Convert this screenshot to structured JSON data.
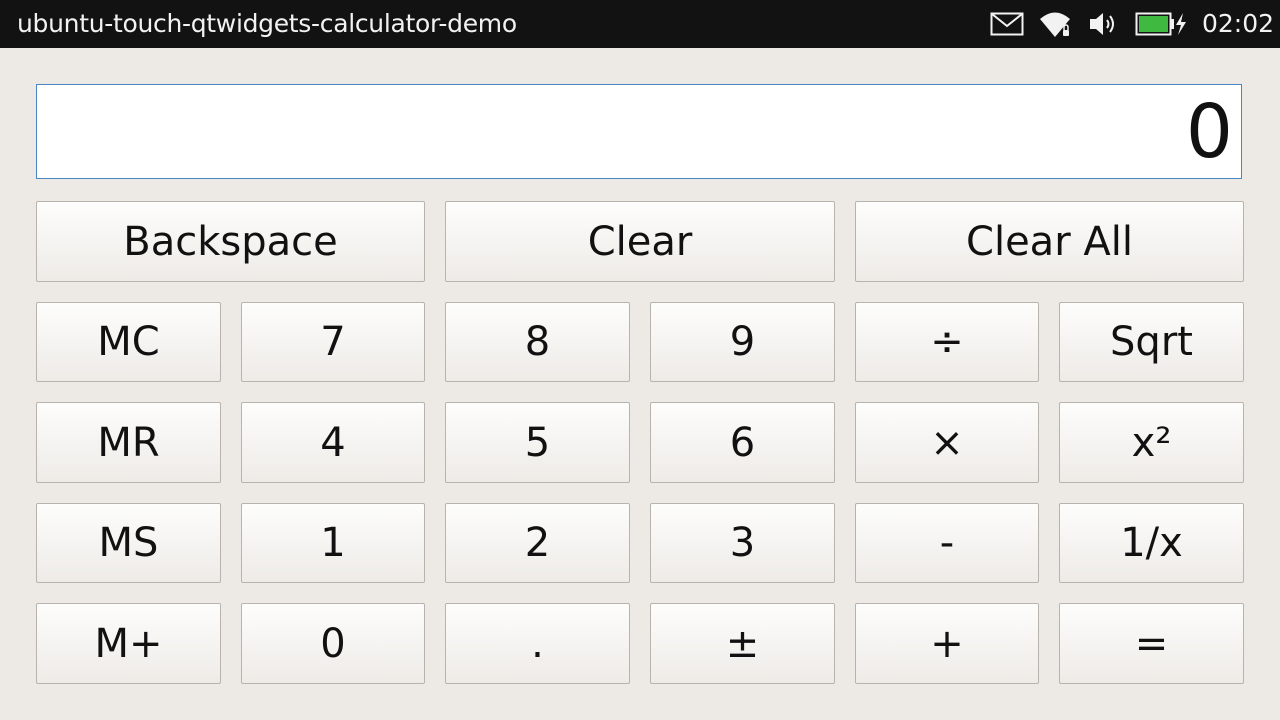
{
  "statusbar": {
    "app_title": "ubuntu-touch-qtwidgets-calculator-demo",
    "clock": "02:02",
    "icons": [
      "mail-icon",
      "wifi-icon",
      "volume-icon",
      "battery-charging-icon"
    ]
  },
  "display": {
    "value": "0"
  },
  "buttons": {
    "backspace": "Backspace",
    "clear": "Clear",
    "clear_all": "Clear All",
    "mc": "MC",
    "mr": "MR",
    "ms": "MS",
    "mplus": "M+",
    "d0": "0",
    "d1": "1",
    "d2": "2",
    "d3": "3",
    "d4": "4",
    "d5": "5",
    "d6": "6",
    "d7": "7",
    "d8": "8",
    "d9": "9",
    "point": ".",
    "sign": "±",
    "divide": "÷",
    "multiply": "×",
    "minus": "-",
    "plus": "+",
    "sqrt": "Sqrt",
    "square": "x²",
    "reciprocal": "1/x",
    "equals": "="
  },
  "colors": {
    "statusbar_bg": "#121212",
    "window_bg": "#edeae6",
    "display_border": "#4a86c5",
    "battery_fill": "#3fb93f"
  }
}
